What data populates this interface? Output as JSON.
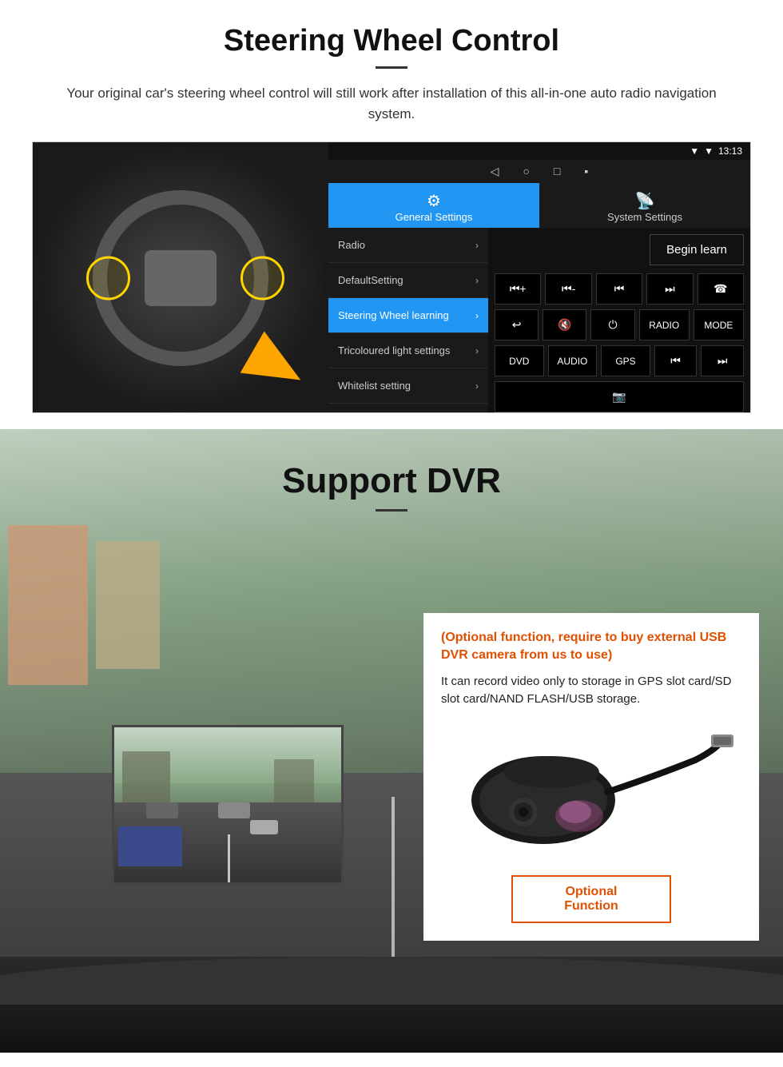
{
  "page": {
    "sections": {
      "steering": {
        "title": "Steering Wheel Control",
        "subtitle": "Your original car's steering wheel control will still work after installation of this all-in-one auto radio navigation system."
      },
      "dvr": {
        "title": "Support DVR"
      }
    }
  },
  "android_ui": {
    "statusbar": {
      "time": "13:13",
      "signal": "▼",
      "wifi": "▼"
    },
    "tabs": {
      "general": {
        "icon": "⚙",
        "label": "General Settings"
      },
      "system": {
        "icon": "📡",
        "label": "System Settings"
      }
    },
    "menu_items": [
      {
        "label": "Radio",
        "active": false
      },
      {
        "label": "DefaultSetting",
        "active": false
      },
      {
        "label": "Steering Wheel learning",
        "active": true
      },
      {
        "label": "Tricoloured light settings",
        "active": false
      },
      {
        "label": "Whitelist setting",
        "active": false
      }
    ],
    "begin_learn_label": "Begin learn",
    "control_buttons": {
      "row1": [
        "⏮+",
        "⏮-",
        "⏮",
        "⏭",
        "☎"
      ],
      "row2": [
        "↩",
        "🔇x",
        "⏻",
        "RADIO",
        "MODE"
      ],
      "row3": [
        "DVD",
        "AUDIO",
        "GPS",
        "⏮",
        "⏭"
      ],
      "row4": [
        "📷"
      ]
    }
  },
  "dvr": {
    "optional_text": "(Optional function, require to buy external USB DVR camera from us to use)",
    "desc_text": "It can record video only to storage in GPS slot card/SD slot card/NAND FLASH/USB storage.",
    "optional_button_label": "Optional Function"
  }
}
